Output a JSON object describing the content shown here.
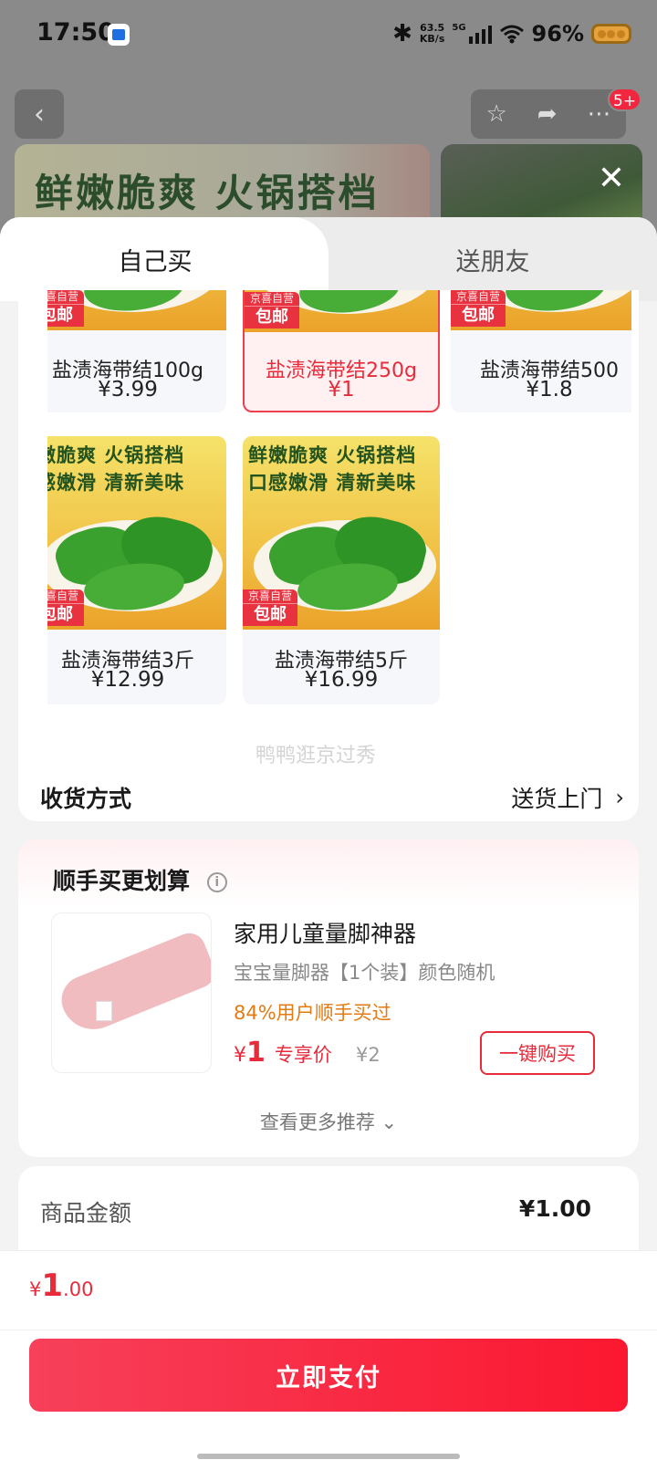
{
  "status": {
    "time": "17:50",
    "net_speed_value": "63.5",
    "net_speed_unit": "KB/s",
    "network": "5G",
    "battery": "96%"
  },
  "background": {
    "banner_text": "鲜嫩脆爽 火锅搭档",
    "badge": "5+"
  },
  "tabs": [
    {
      "label": "自己买",
      "active": true
    },
    {
      "label": "送朋友",
      "active": false
    }
  ],
  "skus": [
    {
      "name": "盐渍海带结100g",
      "price": "¥3.99",
      "selected": false
    },
    {
      "name": "盐渍海带结250g",
      "price": "¥1",
      "selected": true
    },
    {
      "name": "盐渍海带结500",
      "price": "¥1.8",
      "selected": false
    },
    {
      "name": "盐渍海带结3斤",
      "price": "¥12.99",
      "selected": false
    },
    {
      "name": "盐渍海带结5斤",
      "price": "¥16.99",
      "selected": false
    }
  ],
  "sku_slogan": {
    "line1": "鲜嫩脆爽 火锅搭档",
    "line2": "口感嫩滑 清新美味"
  },
  "sku_tag": {
    "top": "京喜自营",
    "bottom": "包邮"
  },
  "watermark": "鸭鸭逛京过秀",
  "delivery": {
    "label": "收货方式",
    "value": "送货上门"
  },
  "recommend": {
    "title": "顺手买更划算",
    "product_name": "家用儿童量脚神器",
    "product_desc": "宝宝量脚器【1个装】颜色随机",
    "stat": "84%用户顺手买过",
    "price_currency": "¥",
    "price": "1",
    "price_label": "专享价",
    "original_price": "¥2",
    "buy_label": "一键购买",
    "more_label": "查看更多推荐"
  },
  "amount": {
    "label": "商品金额",
    "value": "¥1.00"
  },
  "total": {
    "currency": "¥",
    "integer": "1",
    "decimal": ".00"
  },
  "pay_label": "立即支付",
  "colors": {
    "accent": "#e82b3a",
    "pay_button": "#fb1730",
    "stat": "#e47b12"
  }
}
